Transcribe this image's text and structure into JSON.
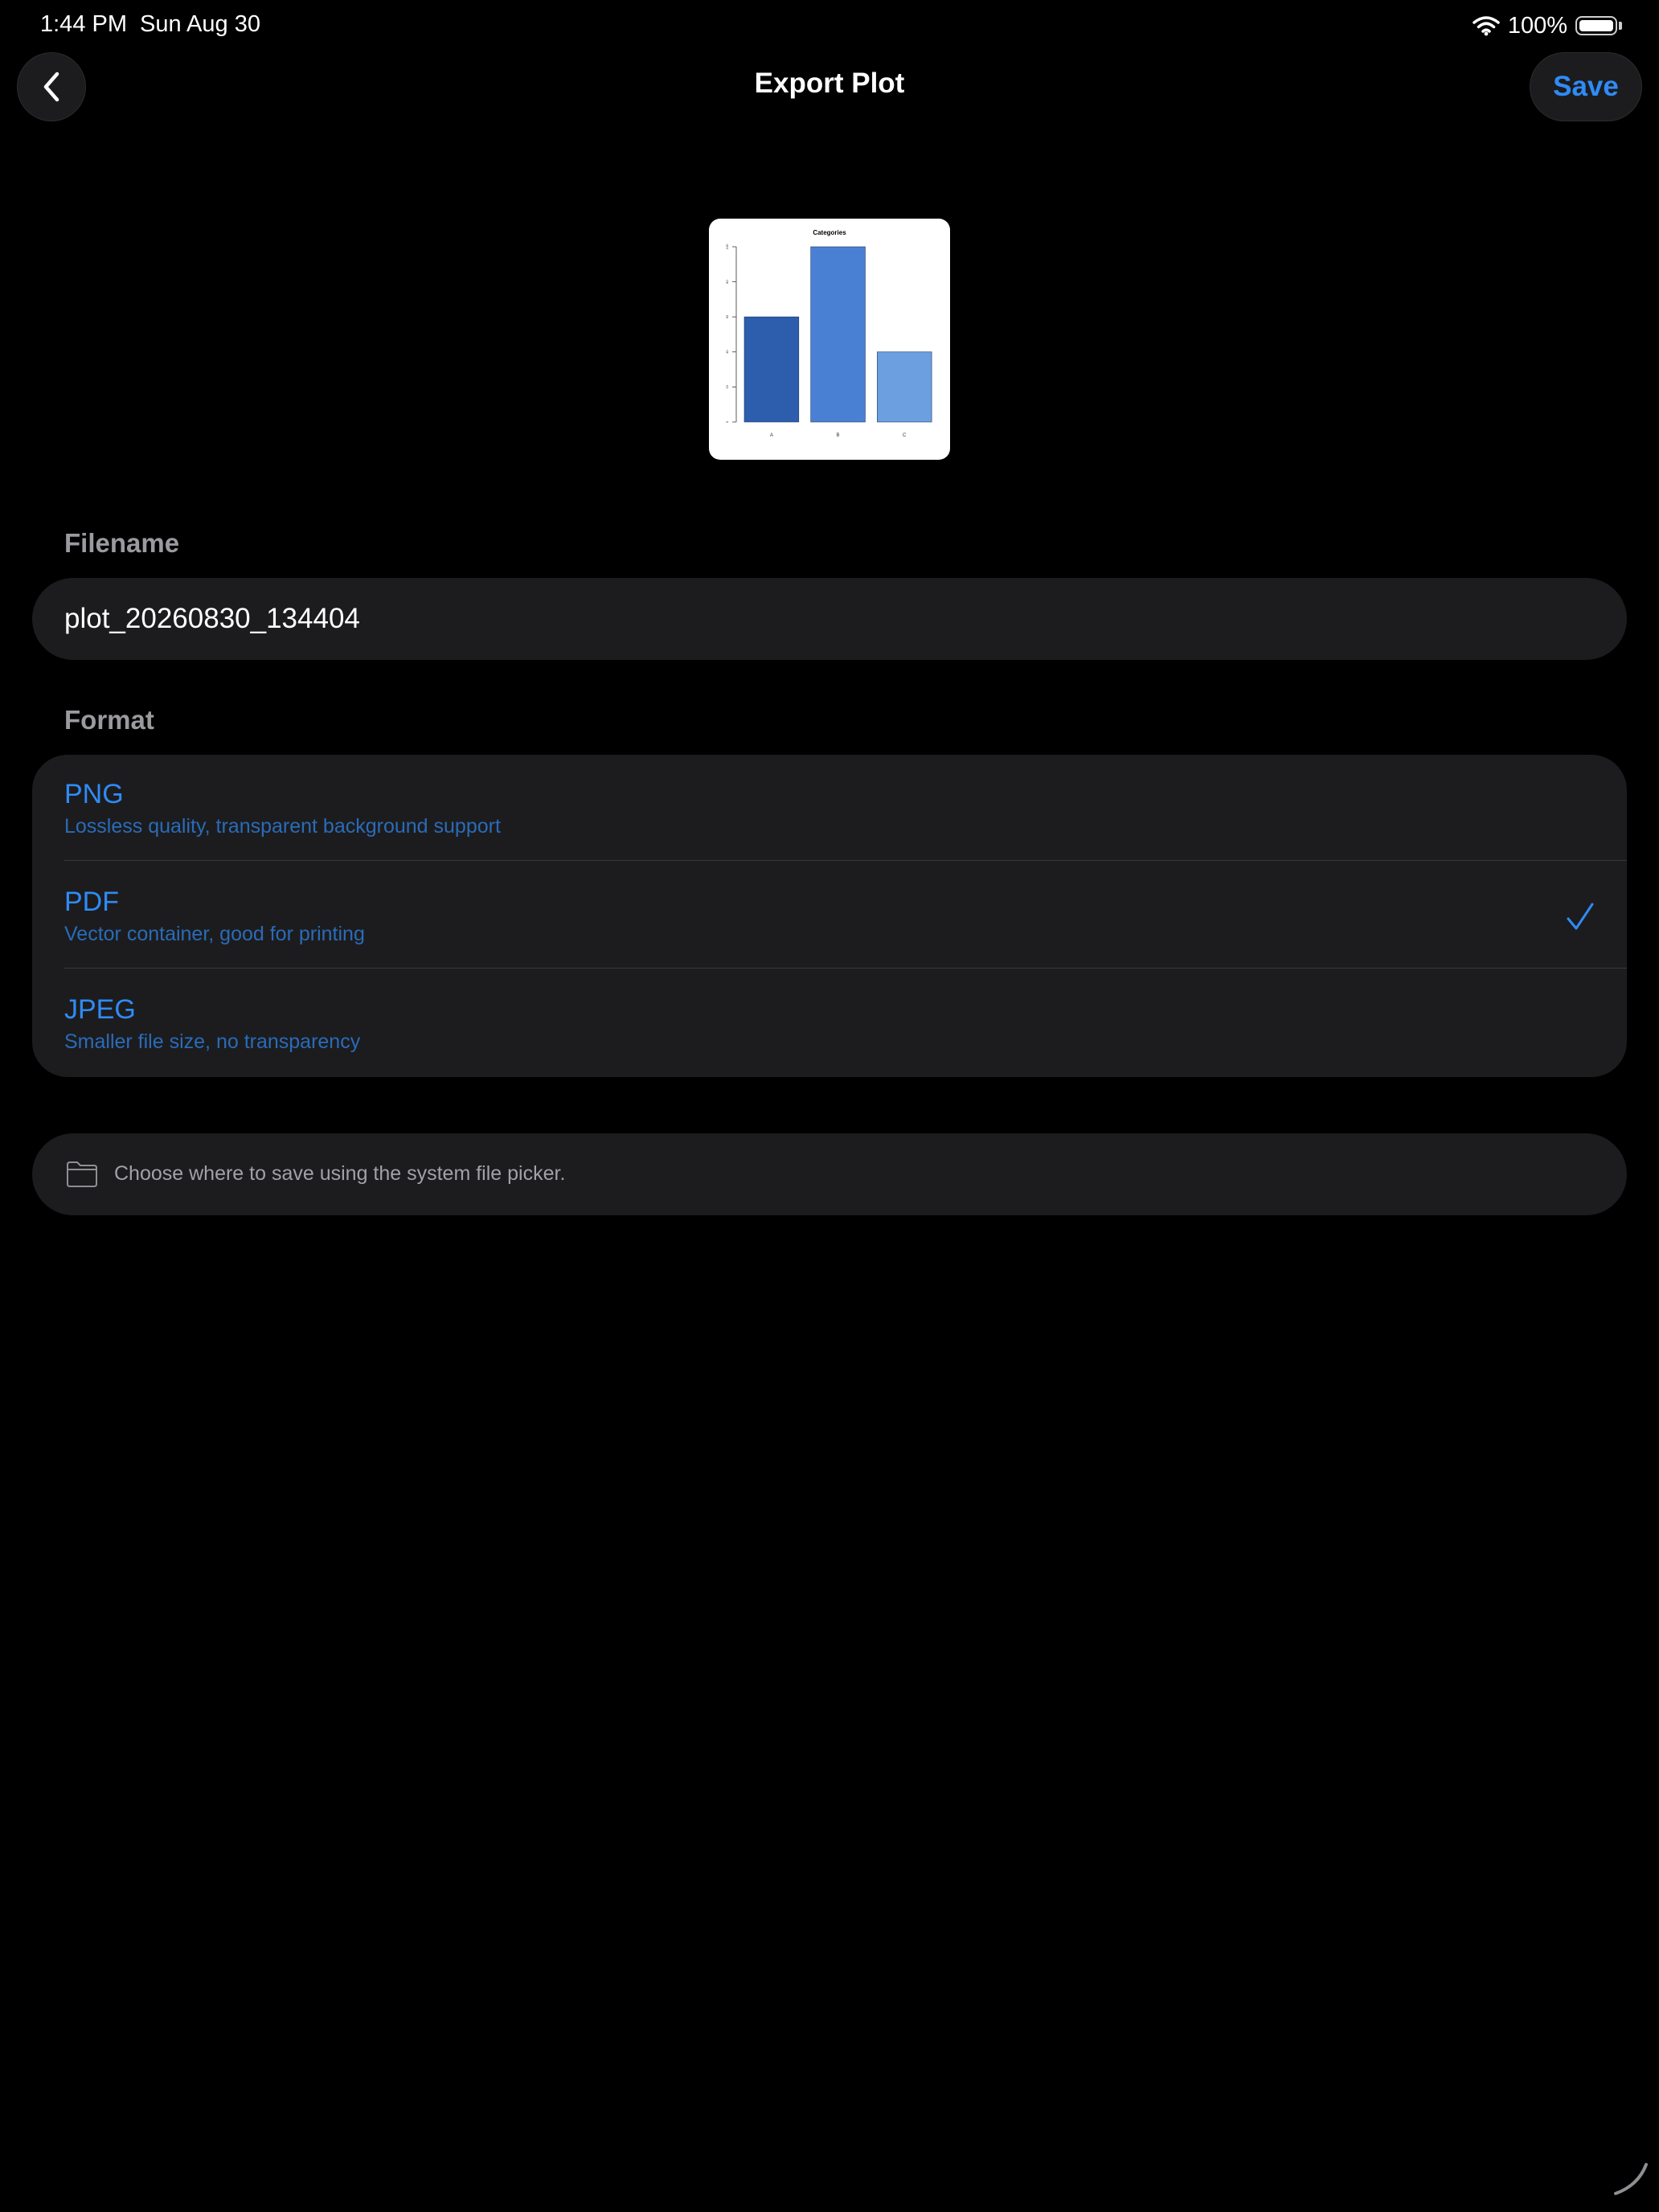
{
  "status_bar": {
    "time": "1:44 PM",
    "date": "Sun Aug 30",
    "battery_percent": "100%",
    "battery_level": 1.0
  },
  "nav": {
    "title": "Export Plot",
    "save_label": "Save",
    "back_icon": "chevron-left-icon"
  },
  "preview": {
    "chart_data": {
      "type": "bar",
      "title": "Categories",
      "categories": [
        "A",
        "B",
        "C"
      ],
      "values": [
        60,
        100,
        40
      ],
      "ylim": [
        0,
        100
      ],
      "yticks": [
        "0",
        "20",
        "40",
        "60",
        "80",
        "100"
      ],
      "colors": [
        "#2d5eae",
        "#4a80d4",
        "#6c9fe0"
      ],
      "grid": false
    }
  },
  "filename": {
    "label": "Filename",
    "value": "plot_20260830_134404"
  },
  "format": {
    "label": "Format",
    "selected": "PDF",
    "options": [
      {
        "title": "PNG",
        "description": "Lossless quality, transparent background support"
      },
      {
        "title": "PDF",
        "description": "Vector container, good for printing"
      },
      {
        "title": "JPEG",
        "description": "Smaller file size, no transparency"
      }
    ]
  },
  "info": {
    "icon": "folder-icon",
    "text": "Choose where to save using the system file picker."
  },
  "colors": {
    "background": "#000000",
    "card": "#1c1c1e",
    "accent": "#2f8bf5",
    "label": "#9a9a9f"
  }
}
